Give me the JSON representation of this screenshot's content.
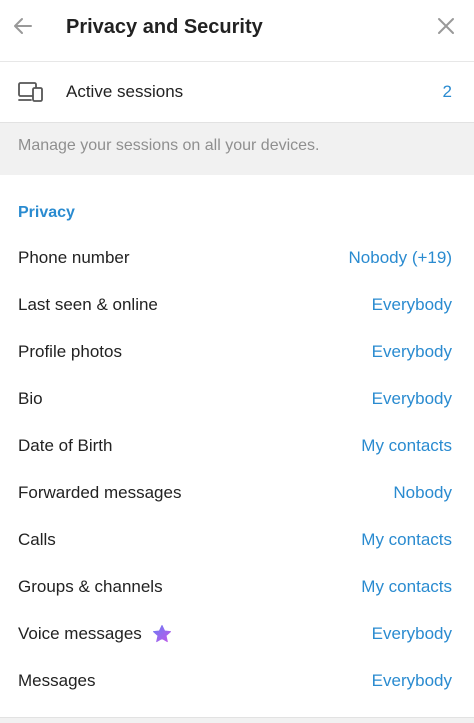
{
  "header": {
    "title": "Privacy and Security",
    "back_icon": "arrow-left-icon",
    "close_icon": "close-icon"
  },
  "sessions": {
    "icon": "devices-icon",
    "label": "Active sessions",
    "count": "2",
    "hint": "Manage your sessions on all your devices."
  },
  "privacy": {
    "section_title": "Privacy",
    "items": [
      {
        "label": "Phone number",
        "value": "Nobody (+19)"
      },
      {
        "label": "Last seen & online",
        "value": "Everybody"
      },
      {
        "label": "Profile photos",
        "value": "Everybody"
      },
      {
        "label": "Bio",
        "value": "Everybody"
      },
      {
        "label": "Date of Birth",
        "value": "My contacts"
      },
      {
        "label": "Forwarded messages",
        "value": "Nobody"
      },
      {
        "label": "Calls",
        "value": "My contacts"
      },
      {
        "label": "Groups & channels",
        "value": "My contacts"
      },
      {
        "label": "Voice messages",
        "value": "Everybody",
        "badge_icon": "premium-star-icon"
      },
      {
        "label": "Messages",
        "value": "Everybody"
      }
    ]
  },
  "colors": {
    "accent": "#2a8bd0",
    "text": "#222222",
    "muted": "#8f8f8f",
    "band": "#f1f1f1",
    "premium_star_start": "#6b7cf5",
    "premium_star_end": "#c158e8"
  }
}
